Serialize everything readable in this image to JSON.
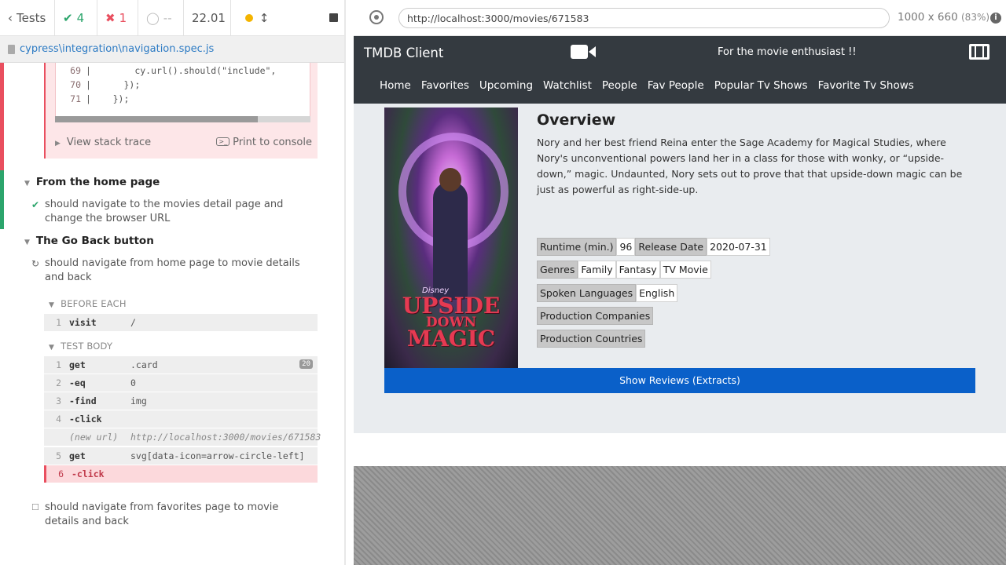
{
  "runner": {
    "tests_label": "Tests",
    "passed": "4",
    "failed": "1",
    "pending": "--",
    "duration": "22.01",
    "spec_path": "cypress\\integration\\navigation.spec.js"
  },
  "code": {
    "lines": [
      {
        "num": "69",
        "text": "        cy.url().should(\"include\","
      },
      {
        "num": "70",
        "text": "      });"
      },
      {
        "num": "71",
        "text": "    });"
      }
    ],
    "view_stack_trace": "View stack trace",
    "print_to_console": "Print to console"
  },
  "suites": [
    {
      "title": "From the home page",
      "tests": [
        {
          "title": "should navigate to the movies detail page and change the browser URL",
          "state": "passed"
        }
      ]
    },
    {
      "title": "The Go Back button",
      "tests": [
        {
          "title": "should navigate from home page to movie details and back",
          "state": "running"
        },
        {
          "title": "should navigate from favorites page to movie details and back",
          "state": "pending"
        }
      ]
    }
  ],
  "hooks": {
    "before_each": "BEFORE EACH",
    "test_body": "TEST BODY",
    "before_cmds": [
      {
        "n": "1",
        "cmd": "visit",
        "val": "/"
      }
    ],
    "body_cmds": [
      {
        "n": "1",
        "cmd": "get",
        "val": ".card",
        "badge": "20"
      },
      {
        "n": "2",
        "cmd": "-eq",
        "val": "0"
      },
      {
        "n": "3",
        "cmd": "-find",
        "val": "img"
      },
      {
        "n": "4",
        "cmd": "-click",
        "val": ""
      },
      {
        "n": "",
        "cmd": "(new url)",
        "val": "http://localhost:3000/movies/671583"
      },
      {
        "n": "5",
        "cmd": "get",
        "val": "svg[data-icon=arrow-circle-left]"
      },
      {
        "n": "6",
        "cmd": "-click",
        "val": ""
      }
    ]
  },
  "aut": {
    "url": "http://localhost:3000/movies/671583",
    "viewport": "1000 x 660",
    "scale": "(83%)",
    "info": "i"
  },
  "app": {
    "brand": "TMDB Client",
    "tagline": "For the movie enthusiast !!",
    "nav": [
      "Home",
      "Favorites",
      "Upcoming",
      "Watchlist",
      "People",
      "Fav People",
      "Popular Tv Shows",
      "Favorite Tv Shows"
    ],
    "overview_title": "Overview",
    "overview_text": "Nory and her best friend Reina enter the Sage Academy for Magical Studies, where Nory's unconventional powers land her in a class for those with wonky, or “upside-down,” magic. Undaunted, Nory sets out to prove that that upside-down magic can be just as powerful as right-side-up.",
    "runtime_label": "Runtime (min.)",
    "runtime": "96",
    "release_label": "Release Date",
    "release_date": "2020-07-31",
    "genres_label": "Genres",
    "genres": [
      "Family",
      "Fantasy",
      "TV Movie"
    ],
    "languages_label": "Spoken Languages",
    "languages": [
      "English"
    ],
    "companies_label": "Production Companies",
    "countries_label": "Production Countries",
    "reviews_button": "Show Reviews (Extracts)",
    "poster_brand": "Disney",
    "poster_title_1": "UPSIDE",
    "poster_title_2": "DOWN",
    "poster_title_3": "MAGIC"
  },
  "colors": {
    "pass": "#2ca56c",
    "fail": "#e94f5f",
    "navbar": "#343a40",
    "primary_button": "#0a60c9"
  }
}
